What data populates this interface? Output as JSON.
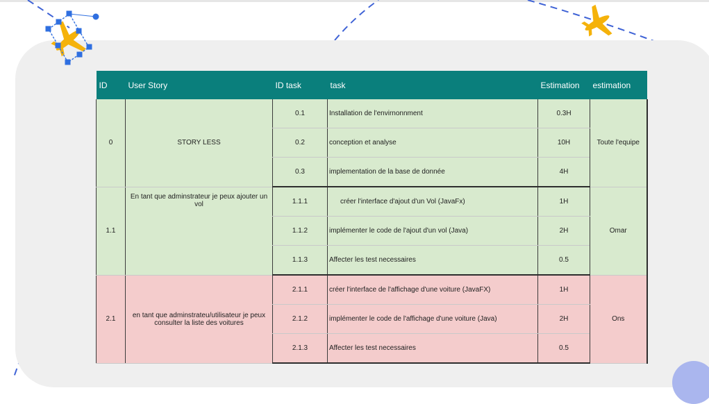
{
  "table": {
    "headers": [
      "ID",
      "User Story",
      "ID task",
      "task",
      "Estimation",
      "estimation"
    ],
    "stories": [
      {
        "id": "0",
        "story": "STORY LESS",
        "assignee": "Toute l'equipe",
        "tasks": [
          {
            "id": "0.1",
            "task": "Installation  de l'envirnonnment",
            "estimation": "0.3H"
          },
          {
            "id": "0.2",
            "task": "conception et analyse",
            "estimation": "10H"
          },
          {
            "id": "0.3",
            "task": "implementation de la base de donnée",
            "estimation": "4H"
          }
        ]
      },
      {
        "id": "1.1",
        "story": "En tant que adminstrateur je peux ajouter un vol",
        "assignee": "Omar",
        "tasks": [
          {
            "id": "1.1.1",
            "task": "créer l'interface d'ajout d'un Vol (JavaFx)",
            "estimation": "1H"
          },
          {
            "id": "1.1.2",
            "task": "implémenter le code de l'ajout d'un vol (Java)",
            "estimation": "2H"
          },
          {
            "id": "1.1.3",
            "task": "Affecter les test necessaires",
            "estimation": "0.5"
          }
        ]
      },
      {
        "id": "2.1",
        "story": "en tant que adminstrateu/utilisateur je peux consulter la liste des voitures",
        "assignee": "Ons",
        "tasks": [
          {
            "id": "2.1.1",
            "task": "créer l'interface de l'affichage d'une voiture (JavaFX)",
            "estimation": "1H"
          },
          {
            "id": "2.1.2",
            "task": "implémenter le code de l'affichage d'une voiture (Java)",
            "estimation": "2H"
          },
          {
            "id": "2.1.3",
            "task": "Affecter les test necessaires",
            "estimation": "0.5"
          }
        ]
      }
    ]
  },
  "colors": {
    "header": "#0a7f7c",
    "green_rows": "#d8eace",
    "red_rows": "#f4cccc",
    "panel": "#efefef",
    "plane": "#f5b20a",
    "dash_line": "#3f63d6",
    "selection": "#2f6fe0",
    "corner_circle": "#aab6ee"
  },
  "icons": [
    "airplane-icon",
    "airplane-icon"
  ]
}
